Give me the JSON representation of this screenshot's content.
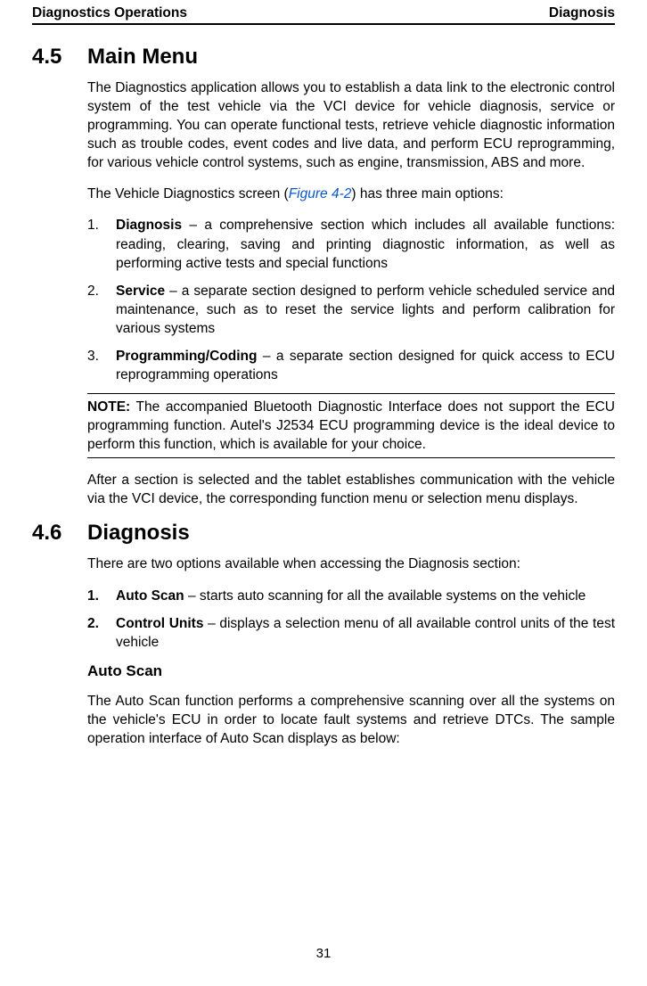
{
  "header": {
    "left": "Diagnostics Operations",
    "right": "Diagnosis"
  },
  "s45": {
    "num": "4.5",
    "title": "Main Menu",
    "intro": "The Diagnostics application allows you to establish a data link to the electronic control system of the test vehicle via the VCI device for vehicle diagnosis, service or programming. You can operate functional tests, retrieve vehicle diagnostic information such as trouble codes, event codes and live data, and perform ECU reprogramming, for various vehicle control systems, such as engine, transmission, ABS and more.",
    "lead_pre": "The Vehicle Diagnostics screen (",
    "figref": "Figure 4-2",
    "lead_post": ") has three main options:",
    "items": [
      {
        "num": "1.",
        "term": "Diagnosis",
        "desc": " – a comprehensive section which includes all available functions: reading, clearing, saving and printing diagnostic information, as well as performing active tests and special functions"
      },
      {
        "num": "2.",
        "term": "Service",
        "desc": " – a separate section designed to perform vehicle scheduled service and maintenance, such as to reset the service lights and perform calibration for various systems"
      },
      {
        "num": "3.",
        "term": "Programming/Coding",
        "desc": " – a separate section designed for quick access to ECU reprogramming operations"
      }
    ],
    "note_label": "NOTE:",
    "note_body": " The accompanied Bluetooth Diagnostic Interface does not support the ECU programming function. Autel's J2534 ECU programming device is the ideal device to perform this function, which is available for your choice.",
    "after": "After a section is selected and the tablet establishes communication with the vehicle via the VCI device, the corresponding function menu or selection menu displays."
  },
  "s46": {
    "num": "4.6",
    "title": "Diagnosis",
    "intro": "There are two options available when accessing the Diagnosis section:",
    "items": [
      {
        "num": "1.",
        "term": "Auto Scan",
        "desc": " – starts auto scanning for all the available systems on the vehicle"
      },
      {
        "num": "2.",
        "term": "Control Units",
        "desc": " – displays a selection menu of all available control units of the test vehicle"
      }
    ],
    "sub_title": "Auto Scan",
    "sub_body": "The Auto Scan function performs a comprehensive scanning over all the systems on the vehicle's ECU in order to locate fault systems and retrieve DTCs. The sample operation interface of Auto Scan displays as below:"
  },
  "page_number": "31"
}
